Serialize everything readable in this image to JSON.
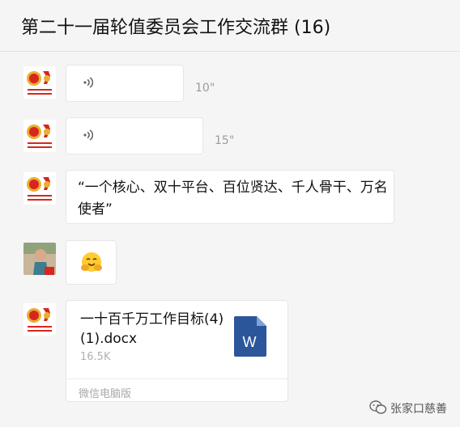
{
  "chat": {
    "title": "第二十一届轮值委员会工作交流群 (16)"
  },
  "messages": [
    {
      "type": "voice",
      "sender_avatar": "committee-emblem-avatar",
      "duration": "10\""
    },
    {
      "type": "voice",
      "sender_avatar": "committee-emblem-avatar",
      "duration": "15\""
    },
    {
      "type": "text",
      "sender_avatar": "committee-emblem-avatar",
      "text": "“一个核心、双十平台、百位贤达、千人骨干、万名使者”"
    },
    {
      "type": "emoji",
      "sender_avatar": "user-photo-avatar",
      "emoji": "hugging-face"
    },
    {
      "type": "file",
      "sender_avatar": "committee-emblem-avatar",
      "file_name": "一十百千万工作目标(4)(1).docx",
      "file_size": "16.5K",
      "file_icon": "word-doc-icon",
      "source": "微信电脑版"
    }
  ],
  "watermark": {
    "icon": "wechat-official-account-icon",
    "text": "张家口慈善"
  },
  "colors": {
    "background": "#f5f5f5",
    "bubble": "#ffffff",
    "word_blue": "#2b579a",
    "emblem_red": "#d7261e",
    "emblem_gold": "#e8b030"
  }
}
